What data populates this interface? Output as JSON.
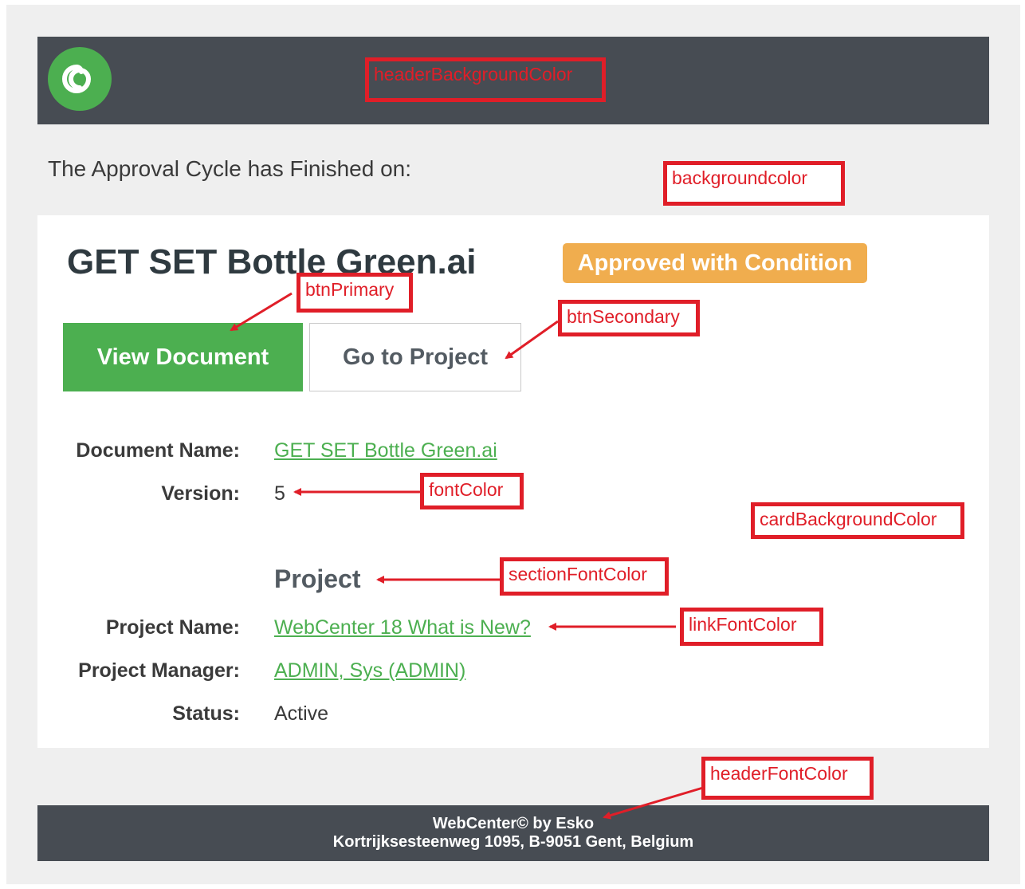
{
  "header": {
    "logo_icon": "webcenter-swirl-icon"
  },
  "intro_text": "The Approval Cycle has Finished on:",
  "card": {
    "document_title": "GET SET Bottle Green.ai",
    "status_badge": "Approved with Condition",
    "buttons": {
      "primary_label": "View Document",
      "secondary_label": "Go to Project"
    },
    "fields": [
      {
        "label": "Document Name:",
        "value": "GET SET Bottle Green.ai"
      },
      {
        "label": "Version:",
        "value": "5"
      }
    ],
    "section_title": "Project",
    "project_fields": [
      {
        "label": "Project Name:",
        "value": "WebCenter 18 What is New?"
      },
      {
        "label": "Project Manager:",
        "value": "ADMIN, Sys (ADMIN)"
      },
      {
        "label": "Status:",
        "value": "Active"
      }
    ]
  },
  "footer": {
    "line1": "WebCenter© by Esko",
    "line2": "Kortrijksesteenweg 1095, B-9051 Gent, Belgium"
  },
  "annotations": {
    "header_bg": "headerBackgroundColor",
    "background": "backgroundcolor",
    "btn_primary": "btnPrimary",
    "btn_secondary": "btnSecondary",
    "font_color": "fontColor",
    "card_bg": "cardBackgroundColor",
    "section_font": "sectionFontColor",
    "link_font": "linkFontColor",
    "header_font": "headerFontColor"
  },
  "colors": {
    "header_background": "#474c53",
    "page_background": "#efefef",
    "card_background": "#ffffff",
    "primary_green": "#4caf50",
    "badge_orange": "#f0ad4e",
    "annotation_red": "#e01e28"
  }
}
